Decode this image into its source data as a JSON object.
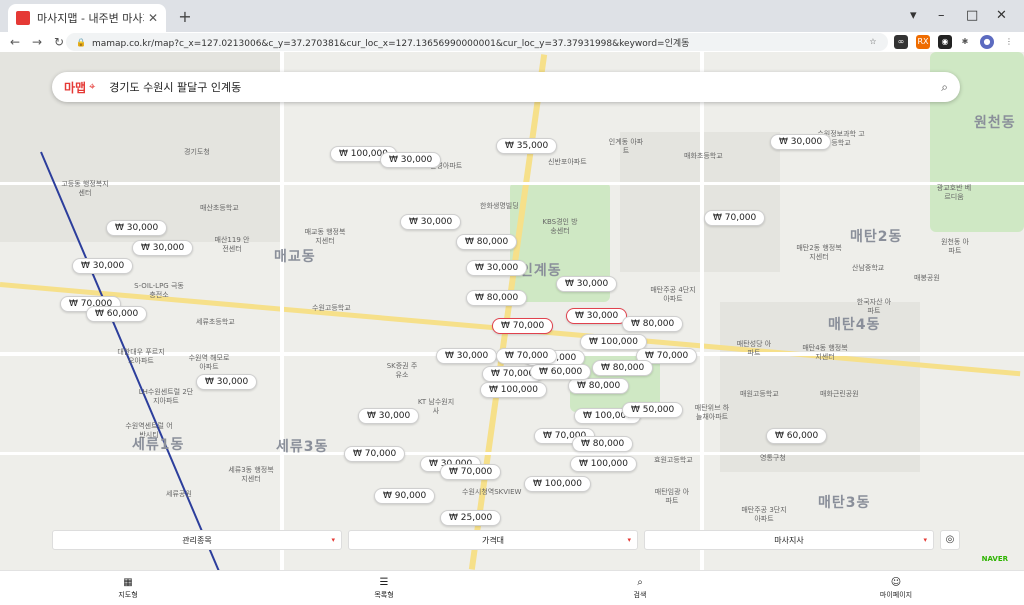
{
  "browser": {
    "tab_title": "마사지맵 - 내주변 마사지 최저가",
    "url": "mamap.co.kr/map?c_x=127.0213006&c_y=37.270381&cur_loc_x=127.13656990000001&cur_loc_y=37.37931998&keyword=인계동",
    "ext_labels": [
      "RX"
    ]
  },
  "search": {
    "logo": "마맵",
    "query": "경기도 수원시 팔달구 인계동"
  },
  "areas": [
    "매교동",
    "세류3동",
    "매탄2동",
    "매탄4동",
    "매탄3동",
    "원천동",
    "세류1동",
    "인계동"
  ],
  "pois": [
    "경기도청",
    "고등동 행정복지센터",
    "매산초등학교",
    "매산119 안전센터",
    "S-OIL-LPG 극동충전소",
    "세류초등학교",
    "대한대우 푸르지오아파트",
    "수원역 해모로아파트",
    "LH수원센트럴 2단지아파트",
    "수원역센트럴 어반시티",
    "세류3동 행정복지센터",
    "세류공원",
    "매교동 행정복지센터",
    "수원고등학교",
    "SK증권 주유소",
    "KT 남수원지사",
    "수원시청역SKVIEW",
    "선경아파트",
    "한화생명빌딩",
    "KBS경인 방송센터",
    "신반포아파트",
    "인계동 아파트",
    "매화초등학교",
    "매탄주공 4단지아파트",
    "매탄성당 아파트",
    "매탄4동 행정복지센터",
    "매원고등학교",
    "매화근린공원",
    "매탄위브 하늘채아파트",
    "효원고등학교",
    "매탄임광 아파트",
    "매탄주공 3단지아파트",
    "영통구청",
    "매탄2동 행정복지센터",
    "산남중학교",
    "매봉공원",
    "한국자산 아파트",
    "원천동 아파트",
    "광교호반 베르디움",
    "수원정보과학 고등학교"
  ],
  "price_pins": [
    {
      "label": "₩ 100,000"
    },
    {
      "label": "₩ 30,000"
    },
    {
      "label": "₩ 35,000"
    },
    {
      "label": "₩ 30,000"
    },
    {
      "label": "₩ 30,000"
    },
    {
      "label": "₩ 70,000"
    },
    {
      "label": "₩ 30,000"
    },
    {
      "label": "₩ 30,000"
    },
    {
      "label": "₩ 80,000"
    },
    {
      "label": "₩ 30,000"
    },
    {
      "label": "₩ 30,000"
    },
    {
      "label": "₩ 80,000"
    },
    {
      "label": "₩ 70,000"
    },
    {
      "label": "₩ 60,000"
    },
    {
      "label": "₩ 70,000"
    },
    {
      "label": "₩ 30,000"
    },
    {
      "label": "₩ 30,000"
    },
    {
      "label": "₩ 80,000"
    },
    {
      "label": "₩ 100,000"
    },
    {
      "label": "₩ 60,000"
    },
    {
      "label": "₩ 70,000"
    },
    {
      "label": "₩ 30,000"
    },
    {
      "label": "₩ 80,000"
    },
    {
      "label": "₩ 70,000"
    },
    {
      "label": "₩ 30,000"
    },
    {
      "label": "₩ 80,000"
    },
    {
      "label": "₩ 100,000"
    },
    {
      "label": "₩ 100,000"
    },
    {
      "label": "₩ 30,000"
    },
    {
      "label": "₩ 70,000"
    },
    {
      "label": "₩ 80,000"
    },
    {
      "label": "₩ 70,000"
    },
    {
      "label": "₩ 30,000"
    },
    {
      "label": "₩ 100,000"
    },
    {
      "label": "₩ 70,000"
    },
    {
      "label": "₩ 100,000"
    },
    {
      "label": "₩ 90,000"
    },
    {
      "label": "₩ 25,000"
    },
    {
      "label": "₩ 60,000"
    },
    {
      "label": "₩ 50,000"
    },
    {
      "label": "₩ 60,000"
    },
    {
      "label": "₩ 70,000"
    }
  ],
  "filters": {
    "filter1": "관리종목",
    "filter2": "가격대",
    "filter3": "마사지사"
  },
  "brand_mark": "NAVER",
  "bottom_nav": [
    {
      "label": "지도형",
      "icon": "map-icon"
    },
    {
      "label": "목록형",
      "icon": "list-icon"
    },
    {
      "label": "검색",
      "icon": "search-icon"
    },
    {
      "label": "마이페이지",
      "icon": "user-icon"
    }
  ]
}
